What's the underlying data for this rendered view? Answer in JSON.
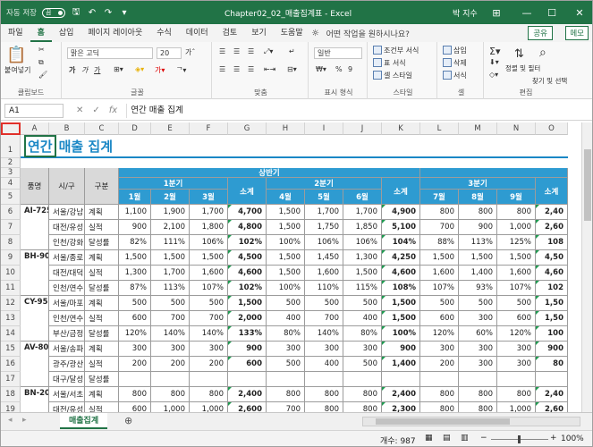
{
  "titlebar": {
    "autosave": "자동 저장",
    "autosave_state": "끔",
    "doc_title": "Chapter02_02_매출집계표 - Excel",
    "user": "박 지수"
  },
  "tabs": [
    "파일",
    "홈",
    "삽입",
    "페이지 레이아웃",
    "수식",
    "데이터",
    "검토",
    "보기",
    "도움말"
  ],
  "active_tab": "홈",
  "tell_me": "어떤 작업을 원하시나요?",
  "share_label": "공유",
  "memo_label": "메모",
  "ribbon": {
    "clipboard": {
      "paste": "붙여넣기",
      "name": "클립보드"
    },
    "font": {
      "name_value": "맑은 고딕",
      "size_value": "20",
      "bold": "가",
      "italic": "가",
      "underline": "가",
      "name": "글꼴"
    },
    "align": {
      "name": "맞춤"
    },
    "number": {
      "format_value": "일반",
      "percent": "%",
      "comma": "9",
      "name": "표시 형식"
    },
    "styles": {
      "cond": "조건부 서식",
      "table": "표 서식",
      "cell": "셀 스타일",
      "name": "스타일"
    },
    "cells": {
      "insert": "삽입",
      "delete": "삭제",
      "format": "서식",
      "name": "셀"
    },
    "edit": {
      "sort": "정렬 및 필터",
      "find": "찾기 및 선택",
      "name": "편집"
    }
  },
  "formula": {
    "namebox": "A1",
    "content": "연간 매출 집계"
  },
  "columns": [
    "A",
    "B",
    "C",
    "D",
    "E",
    "F",
    "G",
    "H",
    "I",
    "J",
    "K",
    "L",
    "M",
    "N",
    "O"
  ],
  "rows": [
    "1",
    "2",
    "3",
    "4",
    "5",
    "6",
    "7",
    "8",
    "9",
    "10",
    "11",
    "12",
    "13",
    "14",
    "15",
    "16",
    "17",
    "18",
    "19"
  ],
  "sheet": {
    "title_a": "연간",
    "title_b": "매출 집계",
    "h_product": "품명",
    "h_region": "시/구",
    "h_type": "구분",
    "h_half": "상반기",
    "h_q1": "1분기",
    "h_q2": "2분기",
    "h_q3": "3분기",
    "h_months": [
      "1월",
      "2월",
      "3월",
      "소계",
      "4월",
      "5월",
      "6월",
      "소계",
      "7월",
      "8월",
      "9월",
      "소계"
    ],
    "data": [
      [
        "AI-725",
        "서울/강남",
        "계획",
        "1,100",
        "1,900",
        "1,700",
        "4,700",
        "1,500",
        "1,700",
        "1,700",
        "4,900",
        "800",
        "800",
        "800",
        "2,40"
      ],
      [
        "",
        "대전/유성",
        "실적",
        "900",
        "2,100",
        "1,800",
        "4,800",
        "1,500",
        "1,750",
        "1,850",
        "5,100",
        "700",
        "900",
        "1,000",
        "2,60"
      ],
      [
        "",
        "인천/강화",
        "달성률",
        "82%",
        "111%",
        "106%",
        "102%",
        "100%",
        "106%",
        "106%",
        "104%",
        "88%",
        "113%",
        "125%",
        "108"
      ],
      [
        "BH-902",
        "서울/종로",
        "계획",
        "1,500",
        "1,500",
        "1,500",
        "4,500",
        "1,500",
        "1,450",
        "1,300",
        "4,250",
        "1,500",
        "1,500",
        "1,500",
        "4,50"
      ],
      [
        "",
        "대전/대덕",
        "실적",
        "1,300",
        "1,700",
        "1,600",
        "4,600",
        "1,500",
        "1,600",
        "1,500",
        "4,600",
        "1,600",
        "1,400",
        "1,600",
        "4,60"
      ],
      [
        "",
        "인천/연수",
        "달성률",
        "87%",
        "113%",
        "107%",
        "102%",
        "100%",
        "110%",
        "115%",
        "108%",
        "107%",
        "93%",
        "107%",
        "102"
      ],
      [
        "CY-959",
        "서울/마포",
        "계획",
        "500",
        "500",
        "500",
        "1,500",
        "500",
        "500",
        "500",
        "1,500",
        "500",
        "500",
        "500",
        "1,50"
      ],
      [
        "",
        "인천/연수",
        "실적",
        "600",
        "700",
        "700",
        "2,000",
        "400",
        "700",
        "400",
        "1,500",
        "600",
        "300",
        "600",
        "1,50"
      ],
      [
        "",
        "부산/금정",
        "달성률",
        "120%",
        "140%",
        "140%",
        "133%",
        "80%",
        "140%",
        "80%",
        "100%",
        "120%",
        "60%",
        "120%",
        "100"
      ],
      [
        "AV-809",
        "서울/송파",
        "계획",
        "300",
        "300",
        "300",
        "900",
        "300",
        "300",
        "300",
        "900",
        "300",
        "300",
        "300",
        "900"
      ],
      [
        "",
        "광주/광산",
        "실적",
        "200",
        "200",
        "200",
        "600",
        "500",
        "400",
        "500",
        "1,400",
        "200",
        "300",
        "300",
        "80"
      ],
      [
        "",
        "대구/달성",
        "달성률",
        "",
        "",
        "",
        "",
        "",
        "",
        "",
        "",
        "",
        "",
        "",
        ""
      ],
      [
        "BN-209",
        "서울/서초",
        "계획",
        "800",
        "800",
        "800",
        "2,400",
        "800",
        "800",
        "800",
        "2,400",
        "800",
        "800",
        "800",
        "2,40"
      ],
      [
        "",
        "대전/유성",
        "실적",
        "600",
        "1,000",
        "1,000",
        "2,600",
        "700",
        "800",
        "800",
        "2,300",
        "800",
        "800",
        "1,000",
        "2,60"
      ]
    ]
  },
  "sheet_tab": "매출집계",
  "status": {
    "count": "개수: 987",
    "zoom": "100%"
  }
}
